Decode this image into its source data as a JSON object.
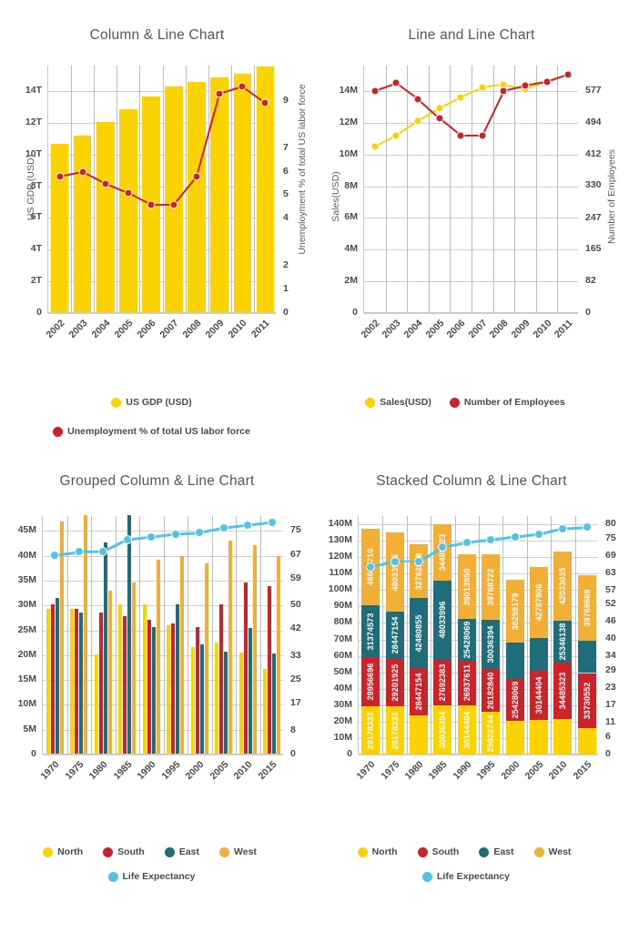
{
  "colors": {
    "yellow": "#FBD303",
    "red": "#CC2229",
    "teal": "#1F6C7B",
    "orange": "#F3AE35",
    "cyan": "#4FC3E8",
    "grid": "#cfcfcf",
    "axis": "#c9c9c9",
    "text": "#4a4a4a",
    "title": "#555658"
  },
  "charts": [
    {
      "id": "column-line",
      "title": "Column & Line Chart",
      "legend": [
        {
          "label": "US GDP (USD)",
          "color": "#FBD303"
        },
        {
          "label": "Unemployment % of total US labor force",
          "color": "#CC2229"
        }
      ],
      "chart_data": {
        "type": "bar",
        "title": "Column & Line Chart",
        "xlabel": "",
        "ylabel": "US GDP (USD)",
        "y2label": "Unemployment % of total US labor force",
        "categories": [
          "2002",
          "2003",
          "2004",
          "2005",
          "2006",
          "2007",
          "2008",
          "2009",
          "2010",
          "2011"
        ],
        "yticks": [
          "0",
          "2T",
          "4T",
          "6T",
          "8T",
          "10T",
          "12T",
          "14T"
        ],
        "ylim": [
          0,
          15.6
        ],
        "y2ticks": [
          "0",
          "1",
          "2",
          "4",
          "5",
          "6",
          "7",
          "9"
        ],
        "y2lim": [
          0,
          10.5
        ],
        "grid": true,
        "legend_position": "bottom",
        "series": [
          {
            "name": "US GDP (USD)",
            "type": "bar",
            "color": "#FBD303",
            "values": [
              10.6,
              11.1,
              12.0,
              12.8,
              13.6,
              14.2,
              14.5,
              14.8,
              15.0,
              15.5
            ]
          },
          {
            "name": "Unemployment % of total US labor force",
            "type": "line",
            "color": "#CC2229",
            "values": [
              5.8,
              6.0,
              5.5,
              5.1,
              4.6,
              4.6,
              5.8,
              9.3,
              9.6,
              8.9
            ]
          }
        ]
      }
    },
    {
      "id": "line-line",
      "title": "Line and Line Chart",
      "legend": [
        {
          "label": "Sales(USD)",
          "color": "#FBD303"
        },
        {
          "label": "Number of Employees",
          "color": "#CC2229"
        }
      ],
      "chart_data": {
        "type": "line",
        "title": "Line and Line Chart",
        "xlabel": "",
        "ylabel": "Sales(USD)",
        "y2label": "Number of Employees",
        "categories": [
          "2002",
          "2003",
          "2004",
          "2005",
          "2006",
          "2007",
          "2008",
          "2009",
          "2010",
          "2011"
        ],
        "yticks": [
          "0",
          "2M",
          "4M",
          "6M",
          "8M",
          "10M",
          "12M",
          "14M"
        ],
        "ylim": [
          0,
          15.6
        ],
        "y2ticks": [
          "0",
          "82",
          "165",
          "247",
          "330",
          "412",
          "494",
          "577"
        ],
        "y2lim": [
          0,
          643
        ],
        "grid": true,
        "legend_position": "bottom",
        "series": [
          {
            "name": "Sales(USD)",
            "type": "line",
            "color": "#FBD303",
            "values": [
              10.5,
              11.2,
              12.1,
              12.9,
              13.6,
              14.2,
              14.4,
              14.1,
              14.6,
              15.0
            ]
          },
          {
            "name": "Number of Employees",
            "type": "line",
            "color": "#CC2229",
            "values": [
              577,
              597,
              556,
              506,
              461,
              461,
              577,
              590,
              600,
              620
            ]
          }
        ]
      }
    },
    {
      "id": "grouped-column-line",
      "title": "Grouped Column & Line Chart",
      "legend_row1": [
        {
          "label": "North",
          "color": "#FBD303"
        },
        {
          "label": "South",
          "color": "#CC2229"
        },
        {
          "label": "East",
          "color": "#1F6C7B"
        },
        {
          "label": "West",
          "color": "#F3AE35"
        }
      ],
      "legend_row2": [
        {
          "label": "Life Expectancy",
          "color": "#4FC3E8"
        }
      ],
      "chart_data": {
        "type": "bar",
        "title": "Grouped Column & Line Chart",
        "xlabel": "",
        "ylabel": "",
        "y2label": "",
        "categories": [
          "1970",
          "1975",
          "1980",
          "1985",
          "1990",
          "1995",
          "2000",
          "2005",
          "2010",
          "2015"
        ],
        "yticks": [
          "0",
          "5M",
          "10M",
          "15M",
          "20M",
          "25M",
          "30M",
          "35M",
          "40M",
          "45M"
        ],
        "ylim": [
          0,
          48
        ],
        "y2ticks": [
          "0",
          "8",
          "17",
          "25",
          "33",
          "42",
          "50",
          "59",
          "67",
          "75"
        ],
        "y2lim": [
          0,
          80
        ],
        "grid": true,
        "legend_position": "bottom",
        "series": [
          {
            "name": "North",
            "type": "bar",
            "color": "#FBD303",
            "values": [
              29.18,
              29.18,
              19.9,
              30.04,
              30.14,
              25.92,
              21.4,
              22.4,
              20.4,
              17.1
            ]
          },
          {
            "name": "South",
            "type": "bar",
            "color": "#CC2229",
            "values": [
              29.96,
              29.2,
              28.45,
              27.69,
              26.94,
              26.18,
              25.43,
              30.14,
              34.49,
              33.73
            ]
          },
          {
            "name": "East",
            "type": "bar",
            "color": "#1F6C7B",
            "values": [
              31.37,
              28.45,
              42.48,
              48.03,
              25.43,
              30.04,
              21.9,
              20.6,
              25.35,
              20.1
            ]
          },
          {
            "name": "West",
            "type": "bar",
            "color": "#F3AE35",
            "values": [
              46.65,
              48.03,
              32.76,
              34.49,
              39.01,
              39.77,
              38.26,
              42.79,
              42.03,
              39.77
            ]
          },
          {
            "name": "Life Expectancy",
            "type": "line",
            "color": "#4FC3E8",
            "values": [
              67,
              68,
              68,
              72,
              73,
              74,
              74.5,
              76,
              77,
              78
            ]
          }
        ]
      }
    },
    {
      "id": "stacked-column-line",
      "title": "Stacked Column & Line Chart",
      "legend_row1": [
        {
          "label": "North",
          "color": "#FBD303"
        },
        {
          "label": "South",
          "color": "#CC2229"
        },
        {
          "label": "East",
          "color": "#1F6C7B"
        },
        {
          "label": "West",
          "color": "#F3AE35"
        }
      ],
      "legend_row2": [
        {
          "label": "Life Expectancy",
          "color": "#4FC3E8"
        }
      ],
      "chart_data": {
        "type": "bar",
        "title": "Stacked Column & Line Chart",
        "stacked": true,
        "xlabel": "",
        "ylabel": "",
        "y2label": "",
        "categories": [
          "1970",
          "1975",
          "1980",
          "1985",
          "1990",
          "1995",
          "2000",
          "2005",
          "2010",
          "2015"
        ],
        "yticks": [
          "0",
          "10M",
          "20M",
          "30M",
          "40M",
          "50M",
          "60M",
          "70M",
          "80M",
          "90M",
          "100M",
          "110M",
          "120M",
          "130M",
          "140M"
        ],
        "ylim": [
          0,
          145
        ],
        "y2ticks": [
          "0",
          "6",
          "11",
          "17",
          "23",
          "29",
          "34",
          "40",
          "46",
          "52",
          "57",
          "63",
          "69",
          "75",
          "80"
        ],
        "y2lim": [
          0,
          82.8
        ],
        "grid": true,
        "legend_position": "bottom",
        "series": [
          {
            "name": "North",
            "type": "bar",
            "color": "#FBD303",
            "values": [
              29178333,
              29178333,
              24000000,
              30036394,
              30144404,
              25922744,
              20500000,
              20800000,
              21400000,
              15800000
            ],
            "labels": [
              "29178333",
              "29178333",
              "",
              "30036394",
              "30144404",
              "25922744",
              "",
              "",
              "",
              ""
            ]
          },
          {
            "name": "South",
            "type": "bar",
            "color": "#CC2229",
            "values": [
              29956696,
              29201925,
              28447154,
              27692383,
              26937611,
              26182840,
              25428069,
              30144404,
              34485323,
              33730552
            ],
            "labels": [
              "29956696",
              "29201925",
              "28447154",
              "27692383",
              "26937611",
              "26182840",
              "25428069",
              "30144404",
              "34485323",
              "33730552"
            ]
          },
          {
            "name": "East",
            "type": "bar",
            "color": "#1F6C7B",
            "values": [
              31374573,
              28447154,
              42480855,
              48033996,
              25428069,
              30036394,
              22000000,
              20000000,
              25346138,
              19800000
            ],
            "labels": [
              "31374573",
              "28447154",
              "42480855",
              "48033996",
              "25428069",
              "30036394",
              "",
              "",
              "25346138",
              ""
            ]
          },
          {
            "name": "West",
            "type": "bar",
            "color": "#F3AE35",
            "values": [
              46645710,
              48033996,
              32762858,
              34485323,
              39013950,
              39768722,
              38259179,
              42787806,
              42033035,
              39768669
            ],
            "labels": [
              "46645710",
              "48033996",
              "32762858",
              "34485323",
              "39013950",
              "39768722",
              "38259179",
              "42787806",
              "42033035",
              "39768669"
            ]
          },
          {
            "name": "Life Expectancy",
            "type": "line",
            "color": "#4FC3E8",
            "values": [
              65,
              67,
              67,
              72,
              73.5,
              74.5,
              75.5,
              76.5,
              78.5,
              79
            ]
          }
        ]
      }
    }
  ]
}
